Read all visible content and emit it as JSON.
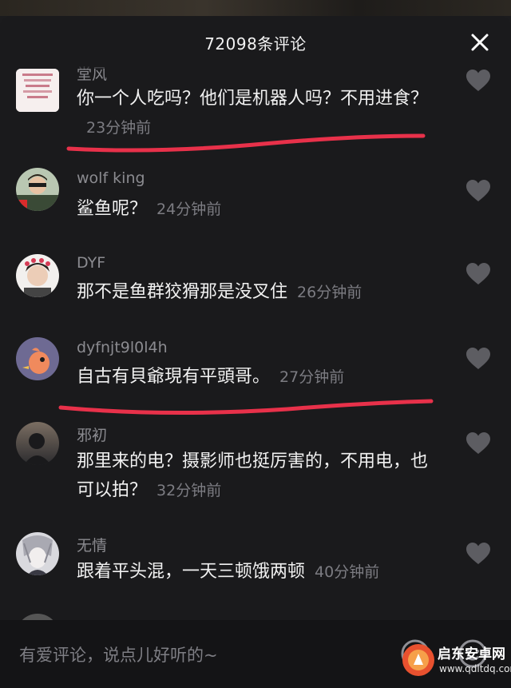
{
  "panel": {
    "title": "72098条评论"
  },
  "comments": [
    {
      "username": "堂风",
      "text": "你一个人吃吗？他们是机器人吗？不用进食？",
      "time": "23分钟前",
      "highlighted": true
    },
    {
      "username": "wolf king",
      "text": "鲨鱼呢？",
      "time": "24分钟前",
      "highlighted": false
    },
    {
      "username": "DYF",
      "text": "那不是鱼群狡猾那是没叉住",
      "time": "26分钟前",
      "highlighted": false
    },
    {
      "username": "dyfnjt9l0l4h",
      "text": "自古有貝爺現有平頭哥。",
      "time": "27分钟前",
      "highlighted": true
    },
    {
      "username": "邪初",
      "text": "那里来的电？摄影师也挺厉害的，不用电，也可以拍？",
      "time": "32分钟前",
      "highlighted": false
    },
    {
      "username": "无情",
      "text": "跟着平头混，一天三顿饿两顿",
      "time": "40分钟前",
      "highlighted": false
    }
  ],
  "input": {
    "placeholder": "有爱评论，说点儿好听的~"
  },
  "watermark": {
    "name": "启东安卓网",
    "url": "www.qdltdq.com"
  },
  "colors": {
    "panel_bg": "#1a1a1c",
    "text": "#f1f1f1",
    "meta": "#8b8b90",
    "annotation": "#e8314a"
  },
  "icons": [
    "close-icon",
    "heart-icon",
    "at-icon",
    "emoji-icon"
  ]
}
